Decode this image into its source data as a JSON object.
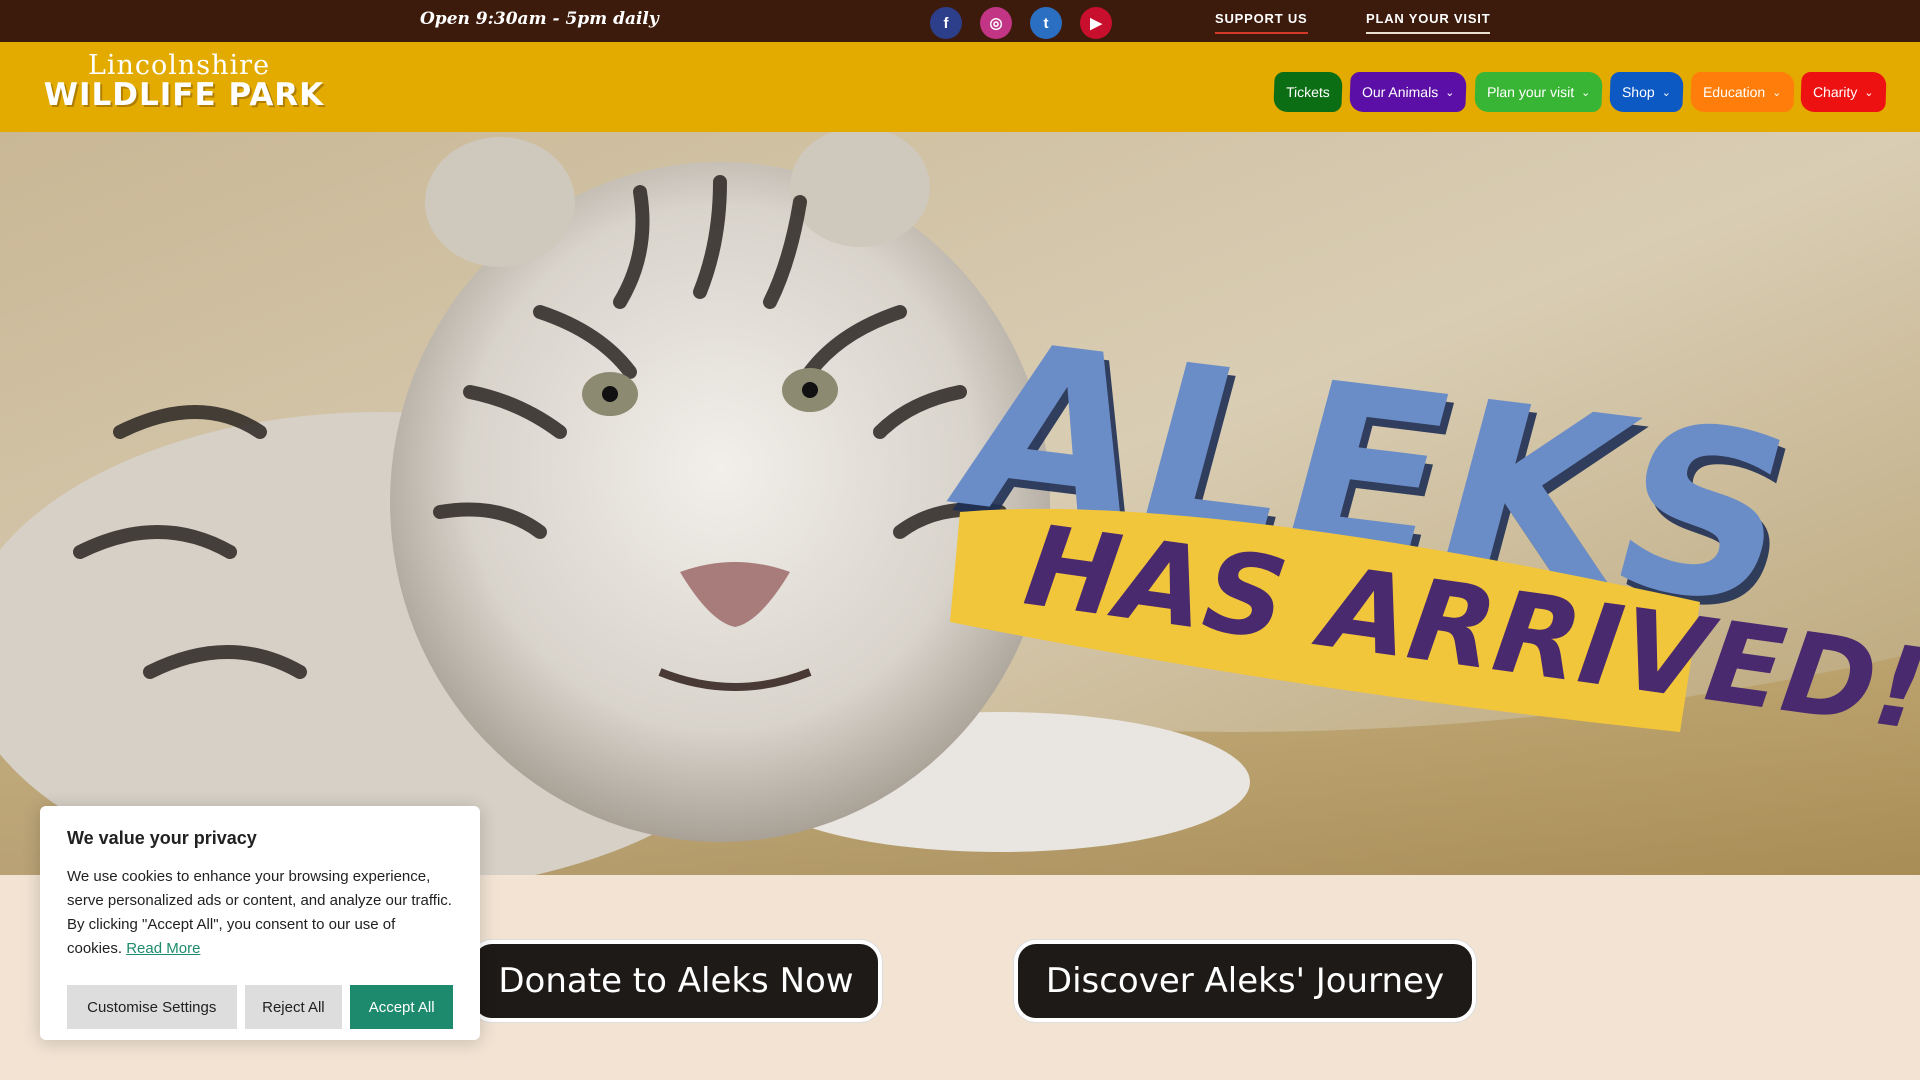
{
  "topbar": {
    "hours": "Open 9:30am - 5pm daily",
    "socials": [
      {
        "icon": "facebook-icon",
        "glyph": "f",
        "color": "#2d3e8a"
      },
      {
        "icon": "instagram-icon",
        "glyph": "◎",
        "color": "#c13584"
      },
      {
        "icon": "twitter-icon",
        "glyph": "t",
        "color": "#2a6fc1"
      },
      {
        "icon": "youtube-icon",
        "glyph": "▶",
        "color": "#c8102e"
      }
    ],
    "support_label": "SUPPORT US",
    "plan_label": "PLAN YOUR VISIT"
  },
  "logo": {
    "line1": "Lincolnshire",
    "line2": "WILDLIFE PARK"
  },
  "nav": [
    {
      "label": "Tickets",
      "color": "#0b6e14",
      "dropdown": false
    },
    {
      "label": "Our Animals",
      "color": "#5b0fa6",
      "dropdown": true
    },
    {
      "label": "Plan your visit",
      "color": "#39b536",
      "dropdown": true
    },
    {
      "label": "Shop",
      "color": "#0d59c4",
      "dropdown": true
    },
    {
      "label": "Education",
      "color": "#ff7d0a",
      "dropdown": true
    },
    {
      "label": "Charity",
      "color": "#ee1111",
      "dropdown": true
    }
  ],
  "hero": {
    "headline": "ALEKS",
    "subheadline": "HAS ARRIVED!"
  },
  "cta": {
    "donate": "Donate to Aleks Now",
    "journey": "Discover Aleks' Journey"
  },
  "cookie": {
    "title": "We value your privacy",
    "body": "We use cookies to enhance your browsing experience, serve personalized ads or content, and analyze our traffic. By clicking \"Accept All\", you consent to our use of cookies.",
    "read_more": "Read More",
    "customise": "Customise Settings",
    "reject": "Reject All",
    "accept": "Accept All"
  }
}
